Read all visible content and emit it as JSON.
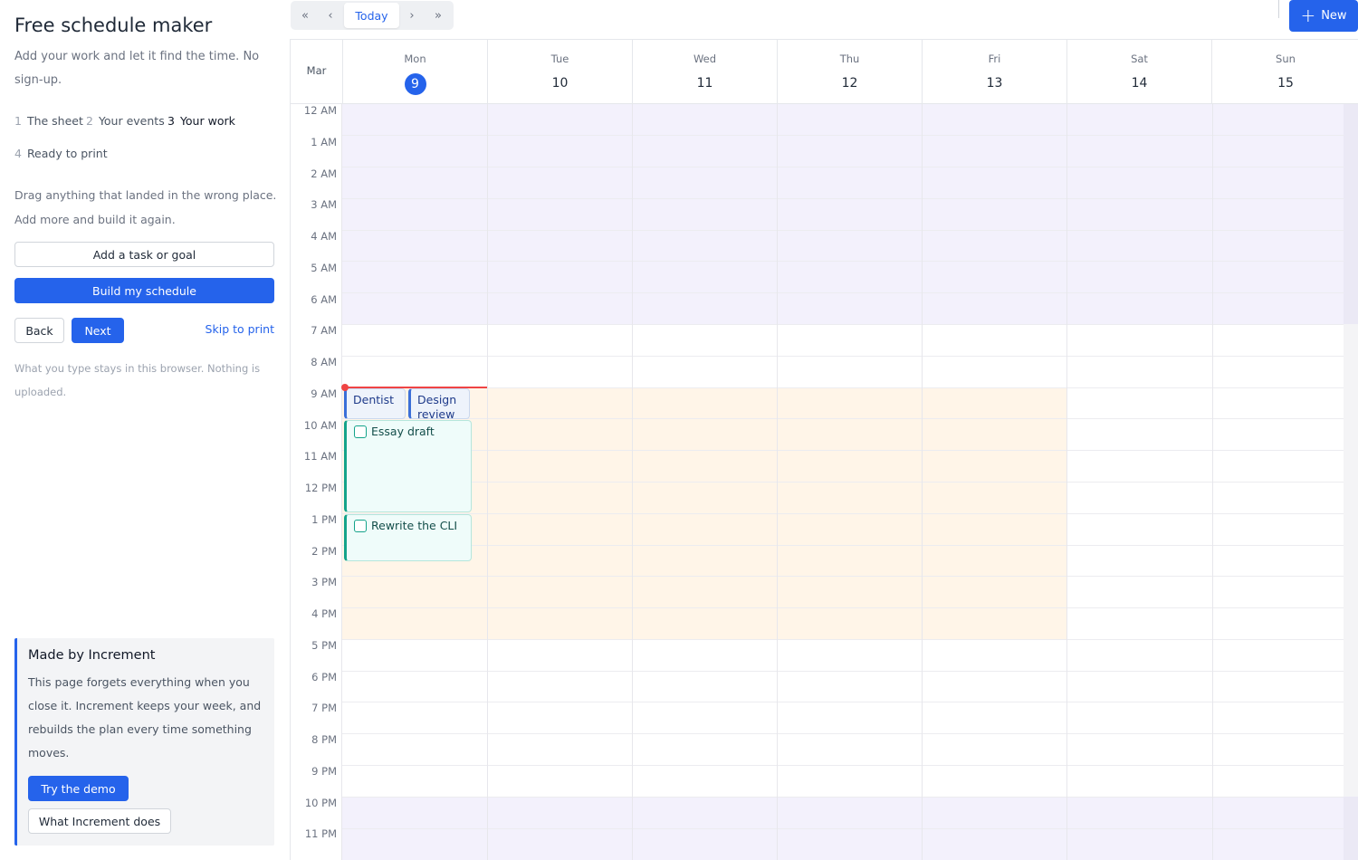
{
  "sidebar": {
    "title": "Free schedule maker",
    "subtitle": "Add your work and let it find the time. No sign-up.",
    "steps": [
      {
        "num": "1",
        "label": "The sheet"
      },
      {
        "num": "2",
        "label": "Your events"
      },
      {
        "num": "3",
        "label": "Your work"
      },
      {
        "num": "4",
        "label": "Ready to print"
      }
    ],
    "active_step": 3,
    "instructions": "Drag anything that landed in the wrong place. Add more and build it again.",
    "add_task_label": "Add a task or goal",
    "build_label": "Build my schedule",
    "back_label": "Back",
    "next_label": "Next",
    "skip_label": "Skip to print",
    "privacy_note": "What you type stays in this browser. Nothing is uploaded.",
    "promo": {
      "title": "Made by Increment",
      "text": "This page forgets everything when you close it. Increment keeps your week, and rebuilds the plan every time something moves.",
      "demo_label": "Try the demo",
      "about_label": "What Increment does"
    }
  },
  "toolbar": {
    "first_label": "«",
    "prev_label": "‹",
    "today_label": "Today",
    "next_label": "›",
    "last_label": "»",
    "new_label": "New",
    "new_icon": "plus-icon"
  },
  "calendar": {
    "month": "Mar",
    "days": [
      {
        "name": "Mon",
        "num": "9",
        "today": true
      },
      {
        "name": "Tue",
        "num": "10"
      },
      {
        "name": "Wed",
        "num": "11"
      },
      {
        "name": "Thu",
        "num": "12"
      },
      {
        "name": "Fri",
        "num": "13"
      },
      {
        "name": "Sat",
        "num": "14"
      },
      {
        "name": "Sun",
        "num": "15"
      }
    ],
    "hours": [
      "12 AM",
      "1 AM",
      "2 AM",
      "3 AM",
      "4 AM",
      "5 AM",
      "6 AM",
      "7 AM",
      "8 AM",
      "9 AM",
      "10 AM",
      "11 AM",
      "12 PM",
      "1 PM",
      "2 PM",
      "3 PM",
      "4 PM",
      "5 PM",
      "6 PM",
      "7 PM",
      "8 PM",
      "9 PM",
      "10 PM",
      "11 PM"
    ],
    "events": [
      {
        "title": "Dentist",
        "kind": "event"
      },
      {
        "title": "Design review",
        "kind": "event"
      },
      {
        "title": "Essay draft",
        "kind": "task"
      },
      {
        "title": "Rewrite the CLI",
        "kind": "task"
      }
    ],
    "colors": {
      "accent": "#2563eb",
      "now_line": "#ef4444",
      "night_shade": "#f3f1fc",
      "work_hours_shade": "#fff5e8",
      "event": "#3b6fd8",
      "task": "#14a38a"
    }
  }
}
